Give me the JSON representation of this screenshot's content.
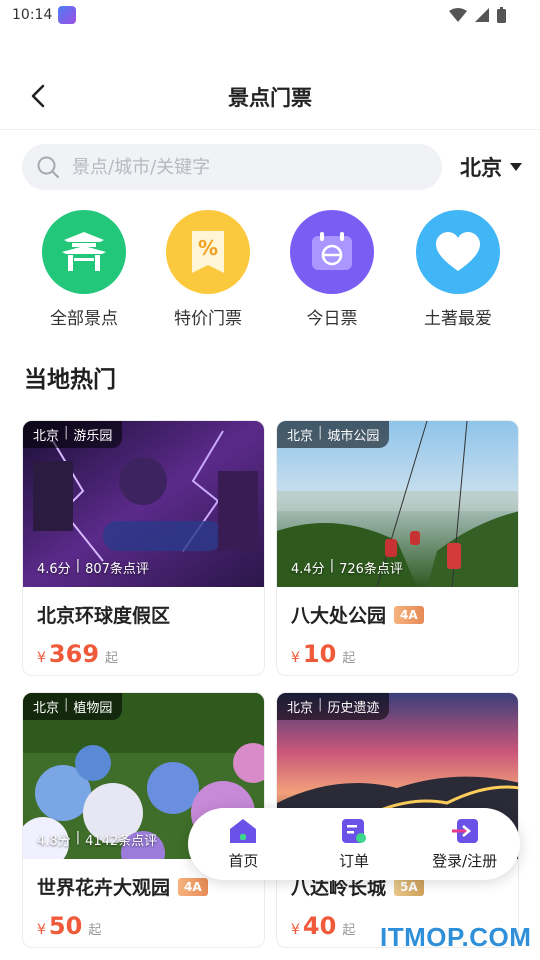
{
  "status": {
    "time": "10:14"
  },
  "header": {
    "title": "景点门票"
  },
  "search": {
    "placeholder": "景点/城市/关键字",
    "city": "北京"
  },
  "categories": [
    {
      "label": "全部景点",
      "icon": "pavilion-icon",
      "color": "#22c77a"
    },
    {
      "label": "特价门票",
      "icon": "discount-ticket-icon",
      "color": "#fbc93d"
    },
    {
      "label": "今日票",
      "icon": "calendar-icon",
      "color": "#7a5df2"
    },
    {
      "label": "土著最爱",
      "icon": "heart-icon",
      "color": "#41b6f7"
    }
  ],
  "section": {
    "title": "当地热门"
  },
  "cards": [
    {
      "city": "北京",
      "type": "游乐园",
      "score": "4.6分",
      "reviews": "807条点评",
      "name": "北京环球度假区",
      "level": "",
      "currency": "¥",
      "price": "369",
      "suffix": "起"
    },
    {
      "city": "北京",
      "type": "城市公园",
      "score": "4.4分",
      "reviews": "726条点评",
      "name": "八大处公园",
      "level": "4A",
      "currency": "¥",
      "price": "10",
      "suffix": "起"
    },
    {
      "city": "北京",
      "type": "植物园",
      "score": "4.8分",
      "reviews": "4142条点评",
      "name": "世界花卉大观园",
      "level": "4A",
      "currency": "¥",
      "price": "50",
      "suffix": "起"
    },
    {
      "city": "北京",
      "type": "历史遗迹",
      "score": "",
      "reviews": "",
      "name": "八达岭长城",
      "level": "5A",
      "currency": "¥",
      "price": "40",
      "suffix": "起"
    }
  ],
  "nav": [
    {
      "label": "首页",
      "icon": "home-icon"
    },
    {
      "label": "订单",
      "icon": "order-icon"
    },
    {
      "label": "登录/注册",
      "icon": "login-icon"
    }
  ],
  "watermark": "ITMOP.COM"
}
